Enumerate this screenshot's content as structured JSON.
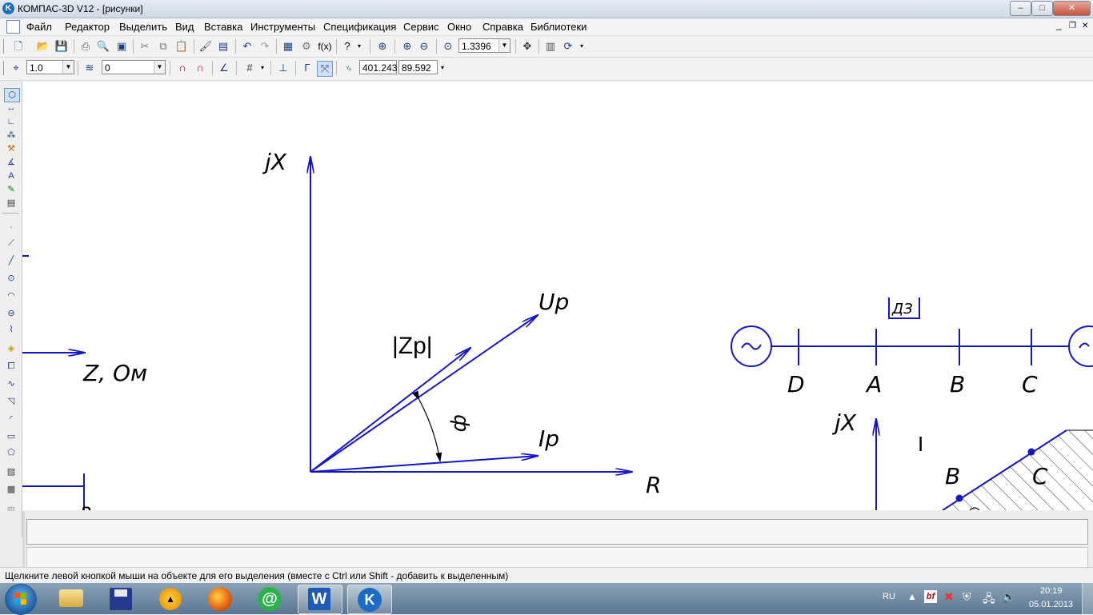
{
  "window": {
    "title": "КОМПАС-3D V12 - [рисунки]",
    "app_icon_letter": "K",
    "buttons": {
      "minimize": "–",
      "maximize": "□",
      "close": "✕"
    },
    "mdi_buttons": {
      "minimize": "_",
      "restore": "❐",
      "close": "✕"
    }
  },
  "menu": {
    "items": [
      "Файл",
      "Редактор",
      "Выделить",
      "Вид",
      "Вставка",
      "Инструменты",
      "Спецификация",
      "Сервис",
      "Окно",
      "Справка",
      "Библиотеки"
    ]
  },
  "toolbar1": {
    "zoom_value": "1.3396",
    "fx_label": "f(x)"
  },
  "toolbar2": {
    "step_value": "1.0",
    "layer_value": "0",
    "coord_x": "401.243",
    "coord_y": "89.592"
  },
  "drawing": {
    "axis_jx_left": "jX",
    "axis_r": "R",
    "vector_up": "Up",
    "vector_zp": "|Zp|",
    "vector_ip": "Ip",
    "angle_phi": "ф",
    "left_label": "Z, Ом",
    "left_partial": "Р",
    "relay_label": "ДЗ",
    "bus_nodes": [
      "D",
      "A",
      "B",
      "C"
    ],
    "axis_jx_right": "jX",
    "char_b": "B",
    "char_c": "C",
    "char_mark": "I"
  },
  "statusbar": {
    "message": "Щелкните левой кнопкой мыши на объекте для его выделения (вместе с Ctrl или Shift - добавить к выделенным)"
  },
  "tray": {
    "lang": "RU",
    "time": "20:19",
    "date": "05.01.2013"
  },
  "colors": {
    "drawing_blue": "#1515c8",
    "taskbar": "#6f8aa3"
  }
}
